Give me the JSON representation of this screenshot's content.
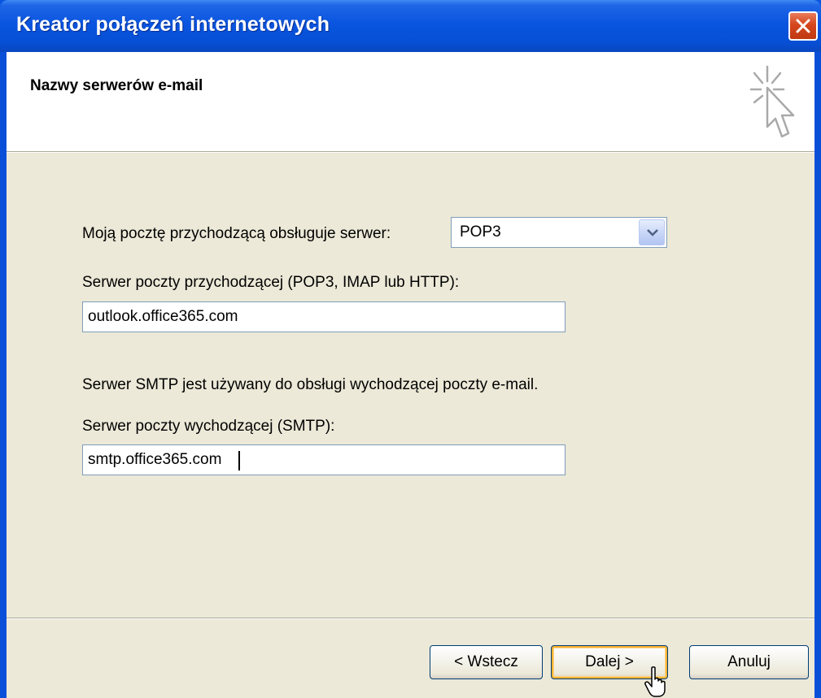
{
  "window": {
    "title": "Kreator połączeń internetowych"
  },
  "header": {
    "title": "Nazwy serwerów e-mail",
    "icon": "wizard-cursor-icon"
  },
  "form": {
    "server_type_label": "Moją pocztę przychodzącą obsługuje serwer:",
    "server_type_value": "POP3",
    "incoming_label": "Serwer poczty przychodzącej (POP3, IMAP lub HTTP):",
    "incoming_value": "outlook.office365.com",
    "smtp_info": "Serwer SMTP jest używany do obsługi wychodzącej poczty e-mail.",
    "outgoing_label": "Serwer poczty wychodzącej (SMTP):",
    "outgoing_value": "smtp.office365.com"
  },
  "buttons": {
    "back": "< Wstecz",
    "next": "Dalej >",
    "cancel": "Anuluj"
  },
  "colors": {
    "titlebar": "#0a55e0",
    "body": "#ece9d8",
    "close": "#d5461d",
    "default_button_highlight": "#f8b333"
  }
}
